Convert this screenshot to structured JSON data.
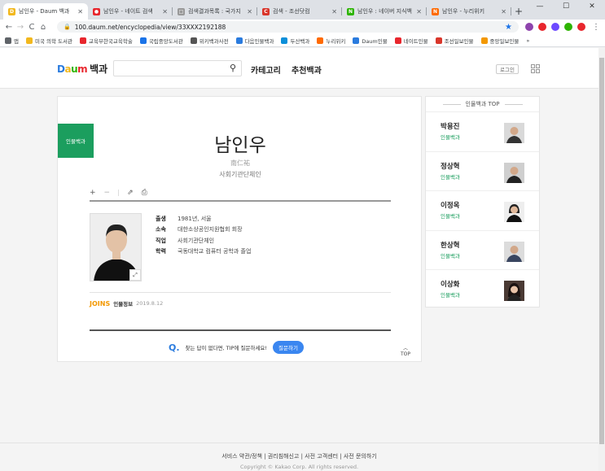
{
  "browser": {
    "tabs": [
      {
        "title": "남인우 - Daum 백과",
        "color": "#f2b81e",
        "glyph": "D",
        "active": true
      },
      {
        "title": "남인우 - 네이트 검색",
        "color": "#e8262d",
        "glyph": "●",
        "active": false
      },
      {
        "title": "검색결과목록 : 국가지",
        "color": "#999999",
        "glyph": "□",
        "active": false
      },
      {
        "title": "검색 - 조선닷컴",
        "color": "#d9362b",
        "glyph": "C",
        "active": false
      },
      {
        "title": "남인우 : 네이버 지식백",
        "color": "#2db400",
        "glyph": "N",
        "active": false
      },
      {
        "title": "남인우 - 누리위키",
        "color": "#ff6a00",
        "glyph": "N",
        "active": false
      }
    ],
    "new_tab_label": "+",
    "window_controls": [
      "—",
      "☐",
      "✕"
    ],
    "nav": {
      "back": "←",
      "forward": "→",
      "reload": "C",
      "home": "⌂"
    },
    "url": "100.daum.net/encyclopedia/view/33XXX2192188",
    "lock": "🔒",
    "star": "★",
    "more": "⋮",
    "extension_colors": [
      "#8e44ad",
      "#e8262d",
      "#6d4aff",
      "#2db400",
      "#4caf50",
      "#e8262d"
    ],
    "bookmarks": [
      {
        "label": "앱",
        "color": "#5f6368"
      },
      {
        "label": "미국 의학 도서관",
        "color": "#f2b81e"
      },
      {
        "label": "교육부한국교육학술",
        "color": "#e8262d"
      },
      {
        "label": "국립중앙도서관",
        "color": "#1a73e8"
      },
      {
        "label": "위키백과사전",
        "color": "#555555"
      },
      {
        "label": "다음인물백과",
        "color": "#2a7bde"
      },
      {
        "label": "두산백과",
        "color": "#0b8fd9"
      },
      {
        "label": "누리위키",
        "color": "#ff6a00"
      },
      {
        "label": "Daum인물",
        "color": "#2a7bde"
      },
      {
        "label": "네이트인물",
        "color": "#e8262d"
      },
      {
        "label": "조선일보인물",
        "color": "#d9362b"
      },
      {
        "label": "중앙일보인물",
        "color": "#f39800"
      }
    ],
    "bookmarks_more": "»"
  },
  "header": {
    "logo_daum": "Daum",
    "logo_baek": "백과",
    "search_icon": "⚲",
    "menu_category": "카테고리",
    "menu_recommend": "추천백과",
    "login": "로그인"
  },
  "article": {
    "category_tag": "인물백과",
    "name": "남인우",
    "hanja": "南仁祐",
    "job": "사회기관단체인",
    "tools": [
      "+",
      "−",
      "⇗",
      "⎙"
    ],
    "info": [
      {
        "key": "출생",
        "value": "1981년, 서울"
      },
      {
        "key": "소속",
        "value": "대한소상공인지원협회 회장"
      },
      {
        "key": "직업",
        "value": "사회기관단체인"
      },
      {
        "key": "학력",
        "value": "국동대학교 컴퓨터 공학과 졸업"
      }
    ],
    "expand_icon": "⤢",
    "source_brand": "JOINS",
    "source_label": "인물정보",
    "source_date": "2019.8.12",
    "ask_text": "찾는 답이 없다면, TIP에 질문하세요!",
    "ask_button": "질문하기",
    "top_label": "TOP",
    "top_arrow": "︿"
  },
  "sidebar": {
    "title": "인물백과 TOP",
    "items": [
      {
        "name": "박용진",
        "category": "인물백과"
      },
      {
        "name": "정상혁",
        "category": "인물백과"
      },
      {
        "name": "이정옥",
        "category": "인물백과"
      },
      {
        "name": "한상혁",
        "category": "인물백과"
      },
      {
        "name": "이상화",
        "category": "인물백과"
      }
    ]
  },
  "footer": {
    "links": "서비스 약관/정책 | 권리침해신고 | 사전 고객센터 | 사전 문의하기",
    "copyright": "Copyright © Kakao Corp. All rights reserved."
  }
}
